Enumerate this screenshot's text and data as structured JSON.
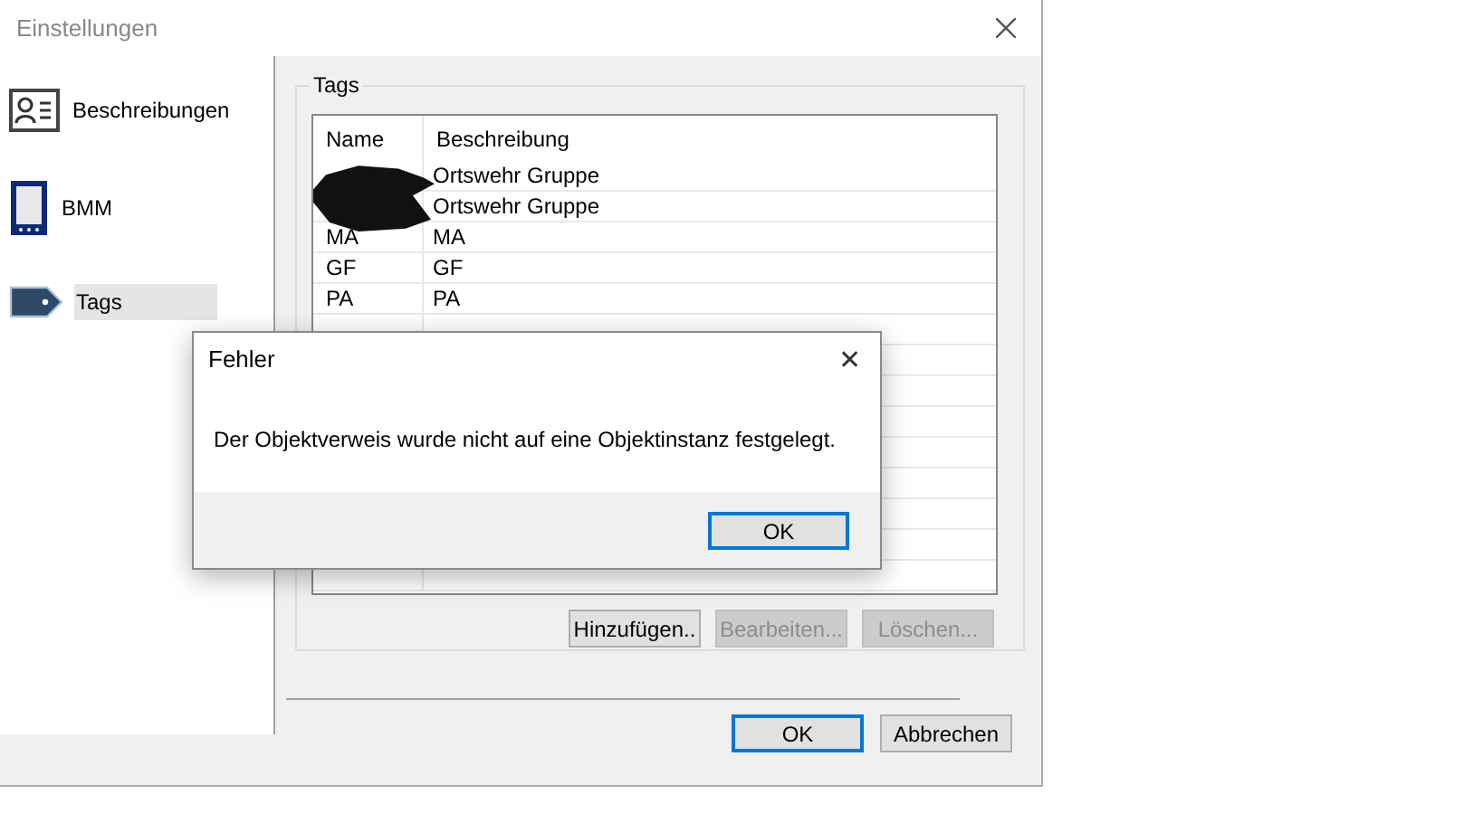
{
  "window": {
    "title": "Einstellungen"
  },
  "sidebar": {
    "items": [
      {
        "kind": "card",
        "label": "Beschreibungen",
        "selected": false
      },
      {
        "kind": "device",
        "label": "BMM",
        "selected": false
      },
      {
        "kind": "tag",
        "label": "Tags",
        "selected": true
      }
    ]
  },
  "group": {
    "title": "Tags"
  },
  "table": {
    "columns": [
      "Name",
      "Beschreibung"
    ],
    "rows": [
      {
        "description": "Ortswehr Gruppe",
        "redacted": true
      },
      {
        "description": "Ortswehr Gruppe",
        "redacted": true
      },
      {
        "name": "MA",
        "description": "MA",
        "redacted": false
      },
      {
        "name": "GF",
        "description": "GF",
        "redacted": false
      },
      {
        "name": "PA",
        "description": "PA",
        "redacted": false
      }
    ]
  },
  "list_buttons": [
    {
      "label": "Hinzufügen..",
      "disabled": false
    },
    {
      "label": "Bearbeiten...",
      "disabled": true
    },
    {
      "label": "Löschen...",
      "disabled": true
    }
  ],
  "footer_buttons": [
    {
      "label": "OK",
      "default": true
    },
    {
      "label": "Abbrechen",
      "default": false
    }
  ],
  "dialog": {
    "title": "Fehler",
    "close": "✕",
    "message": "Der Objektverweis wurde nicht auf eine Objektinstanz festgelegt.",
    "buttons": [
      {
        "label": "OK",
        "default": true
      }
    ]
  }
}
